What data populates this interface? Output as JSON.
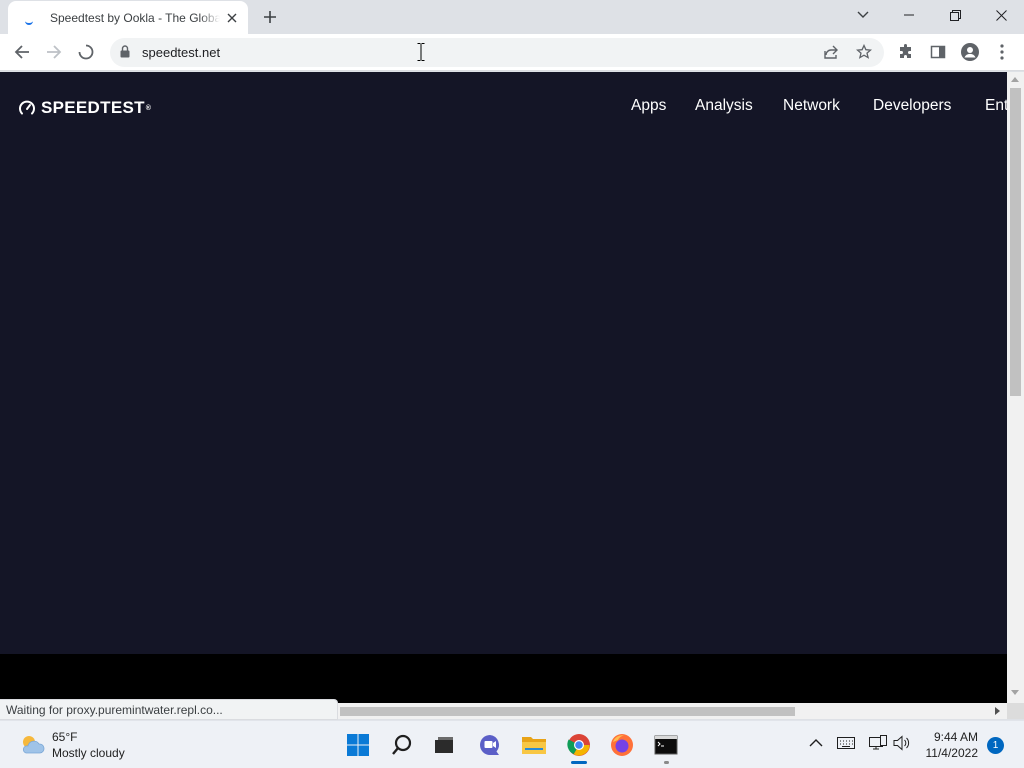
{
  "browser": {
    "tab": {
      "title": "Speedtest by Ookla - The Global"
    },
    "url": "speedtest.net",
    "status_text": "Waiting for proxy.puremintwater.repl.co..."
  },
  "page": {
    "logo_text": "SPEEDTEST",
    "logo_tm": "®",
    "nav": [
      "Apps",
      "Analysis",
      "Network",
      "Developers",
      "Ent"
    ]
  },
  "taskbar": {
    "weather": {
      "temp": "65°F",
      "condition": "Mostly cloudy"
    },
    "clock": {
      "time": "9:44 AM",
      "date": "11/4/2022"
    },
    "notification_count": "1"
  },
  "colors": {
    "page_bg": "#141526",
    "accent": "#1a73e8",
    "taskbar_accent": "#0067c0"
  }
}
